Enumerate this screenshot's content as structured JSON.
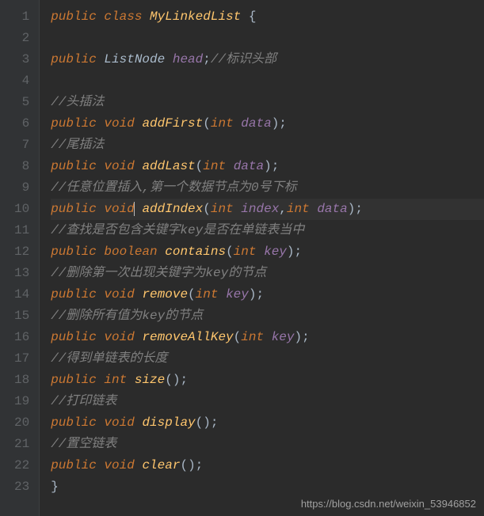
{
  "lineNumbers": [
    "1",
    "2",
    "3",
    "4",
    "5",
    "6",
    "7",
    "8",
    "9",
    "10",
    "11",
    "12",
    "13",
    "14",
    "15",
    "16",
    "17",
    "18",
    "19",
    "20",
    "21",
    "22",
    "23"
  ],
  "code": {
    "l1": {
      "kw1": "public",
      "kw2": "class",
      "name": "MyLinkedList",
      "brace": "{"
    },
    "l3": {
      "kw": "public",
      "type": "ListNode",
      "field": "head",
      "semi": ";",
      "comment": "//标识头部"
    },
    "l5": {
      "comment": "//头插法"
    },
    "l6": {
      "kw": "public",
      "ret": "void",
      "method": "addFirst",
      "paren1": "(",
      "ptype": "int",
      "pname": "data",
      "paren2": ")",
      "semi": ";"
    },
    "l7": {
      "comment": "//尾插法"
    },
    "l8": {
      "kw": "public",
      "ret": "void",
      "method": "addLast",
      "paren1": "(",
      "ptype": "int",
      "pname": "data",
      "paren2": ")",
      "semi": ";"
    },
    "l9": {
      "comment": "//任意位置插入,第一个数据节点为0号下标"
    },
    "l10": {
      "kw": "public",
      "ret": "void",
      "method": "addIndex",
      "paren1": "(",
      "ptype1": "int",
      "pname1": "index",
      "comma": ",",
      "ptype2": "int",
      "pname2": "data",
      "paren2": ")",
      "semi": ";"
    },
    "l11": {
      "comment": "//查找是否包含关键字key是否在单链表当中"
    },
    "l12": {
      "kw": "public",
      "ret": "boolean",
      "method": "contains",
      "paren1": "(",
      "ptype": "int",
      "pname": "key",
      "paren2": ")",
      "semi": ";"
    },
    "l13": {
      "comment": "//删除第一次出现关键字为key的节点"
    },
    "l14": {
      "kw": "public",
      "ret": "void",
      "method": "remove",
      "paren1": "(",
      "ptype": "int",
      "pname": "key",
      "paren2": ")",
      "semi": ";"
    },
    "l15": {
      "comment": "//删除所有值为key的节点"
    },
    "l16": {
      "kw": "public",
      "ret": "void",
      "method": "removeAllKey",
      "paren1": "(",
      "ptype": "int",
      "pname": "key",
      "paren2": ")",
      "semi": ";"
    },
    "l17": {
      "comment": "//得到单链表的长度"
    },
    "l18": {
      "kw": "public",
      "ret": "int",
      "method": "size",
      "paren1": "(",
      "paren2": ")",
      "semi": ";"
    },
    "l19": {
      "comment": "//打印链表"
    },
    "l20": {
      "kw": "public",
      "ret": "void",
      "method": "display",
      "paren1": "(",
      "paren2": ")",
      "semi": ";"
    },
    "l21": {
      "comment": "//置空链表"
    },
    "l22": {
      "kw": "public",
      "ret": "void",
      "method": "clear",
      "paren1": "(",
      "paren2": ")",
      "semi": ";"
    },
    "l23": {
      "brace": "}"
    }
  },
  "watermark": "https://blog.csdn.net/weixin_53946852"
}
